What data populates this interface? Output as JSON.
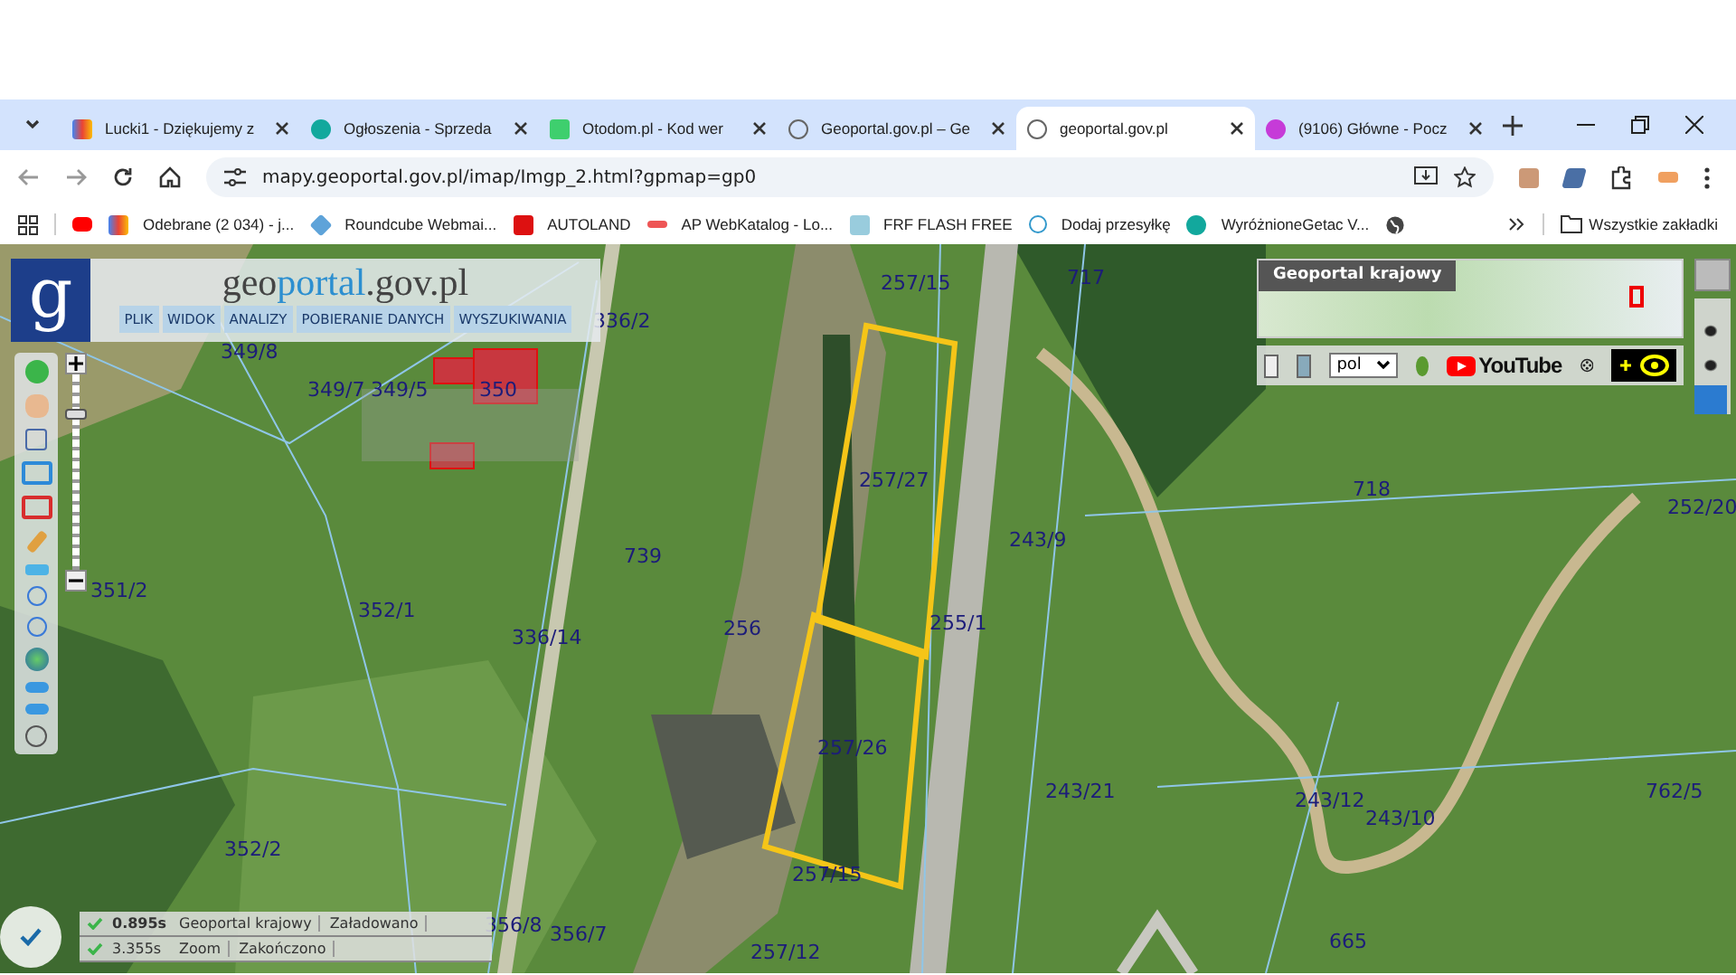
{
  "browser": {
    "tabs": [
      {
        "title": "Lucki1 - Dziękujemy z",
        "selected": false
      },
      {
        "title": "Ogłoszenia - Sprzeda",
        "selected": false
      },
      {
        "title": "Otodom.pl - Kod wer",
        "selected": false
      },
      {
        "title": "Geoportal.gov.pl – Ge",
        "selected": false
      },
      {
        "title": "geoportal.gov.pl",
        "selected": true
      },
      {
        "title": "(9106) Główne - Pocz",
        "selected": false
      }
    ],
    "url": "mapy.geoportal.gov.pl/imap/Imgp_2.html?gpmap=gp0",
    "bookmarks": [
      "Odebrane (2 034) - j...",
      "Roundcube Webmai...",
      "AUTOLAND",
      "AP WebKatalog - Lo...",
      "FRF FLASH FREE",
      "Dodaj przesyłkę",
      "WyróżnioneGetac V..."
    ],
    "all_bookmarks": "Wszystkie zakładki"
  },
  "geoportal": {
    "logo_letter": "g",
    "title_parts": [
      "geo",
      "portal",
      ".gov.pl"
    ],
    "menu": [
      "PLIK",
      "WIDOK",
      "ANALIZY",
      "POBIERANIE DANYCH",
      "WYSZUKIWANIA"
    ],
    "zoom": {
      "level": 0.8
    },
    "overview_title": "Geoportal krajowy",
    "language": "pol",
    "youtube": "YouTube",
    "status": [
      {
        "time": "0.895s",
        "service": "Geoportal krajowy",
        "state": "Załadowano"
      },
      {
        "time": "3.355s",
        "service": "Zoom",
        "state": "Zakończono"
      }
    ]
  },
  "parcels": [
    "336/2",
    "349/8",
    "349/7",
    "349/5",
    "350",
    "257/15",
    "717",
    "257/27",
    "718",
    "252/20",
    "243/9",
    "739",
    "255/1",
    "351/2",
    "352/1",
    "336/14",
    "256",
    "257/26",
    "243/21",
    "243/12",
    "243/10",
    "762/5",
    "352/2",
    "257/15",
    "356/8",
    "356/7",
    "257/12",
    "665"
  ]
}
